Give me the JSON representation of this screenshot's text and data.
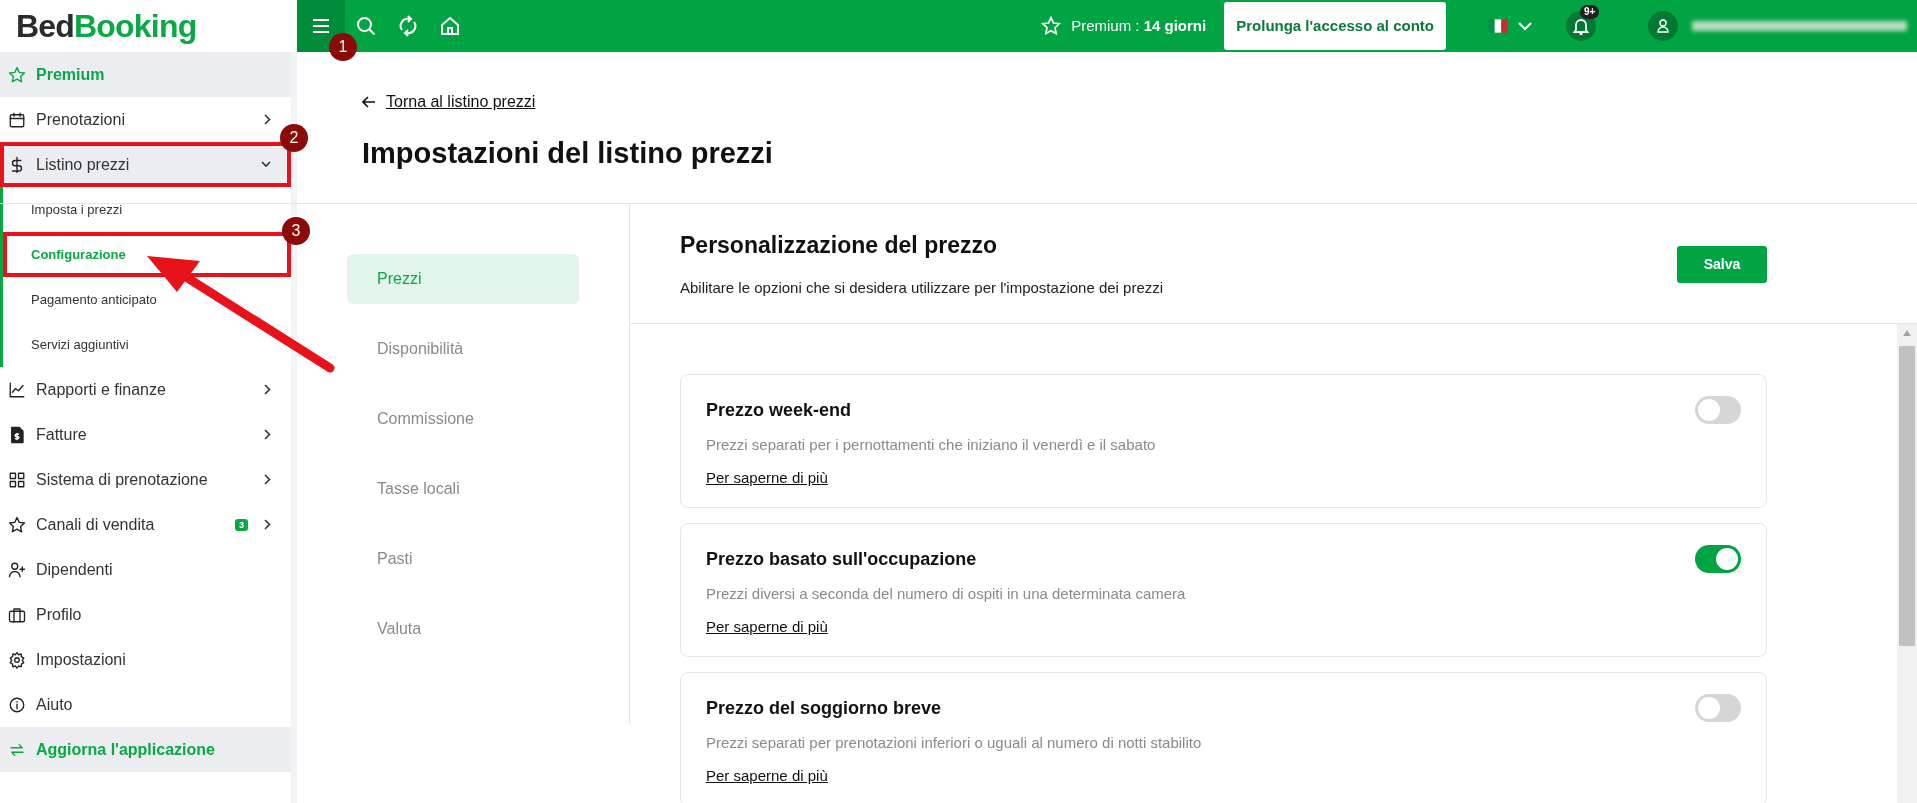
{
  "logo": {
    "part_1": "Bed",
    "part_2": "Booking"
  },
  "topbar": {
    "premium": "Premium : **14 giorni**",
    "extend_button": "Prolunga l'accesso al conto",
    "notification_count": "9+"
  },
  "sidebar": {
    "items": [
      {
        "label": "Premium",
        "kind": "highlight"
      },
      {
        "label": "Prenotazioni",
        "kind": "item",
        "expanded": false
      },
      {
        "label": "Listino prezzi",
        "kind": "item",
        "expanded": true,
        "children": [
          {
            "label": "Imposta i prezzi",
            "selected": false
          },
          {
            "label": "Configurazione",
            "selected": true
          },
          {
            "label": "Pagamento anticipato",
            "selected": false
          },
          {
            "label": "Servizi aggiuntivi",
            "selected": false
          }
        ]
      },
      {
        "label": "Rapporti e finanze",
        "kind": "item",
        "expanded": false
      },
      {
        "label": "Fatture",
        "kind": "item",
        "expanded": false
      },
      {
        "label": "Sistema di prenotazione",
        "kind": "item",
        "expanded": false
      },
      {
        "label": "Canali di vendita",
        "kind": "item",
        "expanded": false,
        "badge": "3"
      },
      {
        "label": "Dipendenti",
        "kind": "item"
      },
      {
        "label": "Profilo",
        "kind": "item"
      },
      {
        "label": "Impostazioni",
        "kind": "item"
      },
      {
        "label": "Aiuto",
        "kind": "item"
      },
      {
        "label": "Aggiorna l'applicazione",
        "kind": "highlight"
      }
    ]
  },
  "page": {
    "back_link": "Torna al listino prezzi",
    "title": "Impostazioni del listino prezzi"
  },
  "tabs": [
    {
      "label": "Prezzi",
      "selected": true
    },
    {
      "label": "Disponibilità",
      "selected": false
    },
    {
      "label": "Commissione",
      "selected": false
    },
    {
      "label": "Tasse locali",
      "selected": false
    },
    {
      "label": "Pasti",
      "selected": false
    },
    {
      "label": "Valuta",
      "selected": false
    }
  ],
  "panel": {
    "title": "Personalizzazione del prezzo",
    "subtitle": "Abilitare le opzioni che si desidera utilizzare per l'impostazione dei prezzi",
    "save_button": "Salva",
    "options": [
      {
        "title": "Prezzo week-end",
        "description": "Prezzi separati per i pernottamenti che iniziano il venerdì e il sabato",
        "link": "Per saperne di più",
        "on": false
      },
      {
        "title": "Prezzo basato sull'occupazione",
        "description": "Prezzi diversi a seconda del numero di ospiti in una determinata camera",
        "link": "Per saperne di più",
        "on": true
      },
      {
        "title": "Prezzo del soggiorno breve",
        "description": "Prezzi separati per prenotazioni inferiori o uguali al numero di notti stabilito",
        "link": "Per saperne di più",
        "on": false
      }
    ]
  },
  "annotations": [
    {
      "label": "1"
    },
    {
      "label": "2"
    },
    {
      "label": "3"
    }
  ]
}
